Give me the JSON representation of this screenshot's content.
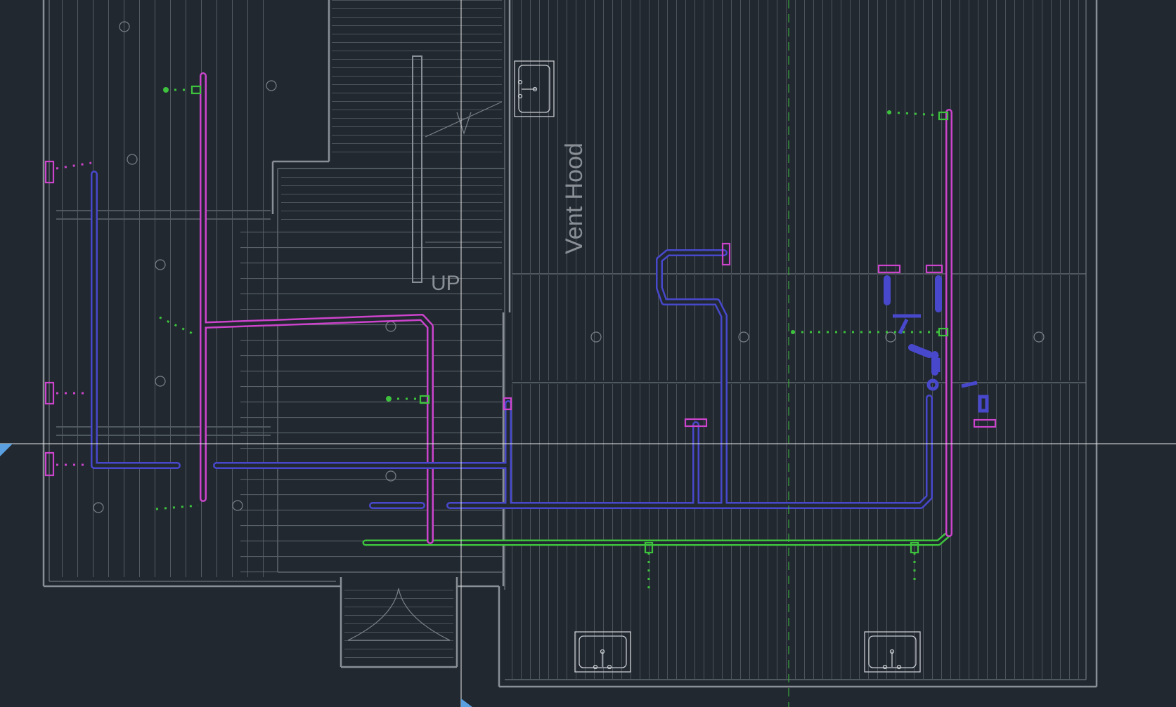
{
  "canvas": {
    "background": "#212830"
  },
  "labels": {
    "vent_hood": "Vent Hood",
    "up": "UP"
  },
  "colors": {
    "walls": "#8a8f96",
    "hatch": "#5f656c",
    "hot_water_pipe": "#cc44cc",
    "cold_water_pipe": "#4848cc",
    "gas_pipe": "#3ec23e",
    "crosshair": "#e8e8e8",
    "cursor_marker": "#5aa0e0"
  },
  "legend_icons": [
    "sink-fixture-icon",
    "crosshair-cursor-icon",
    "pipe-fitting-icon"
  ]
}
